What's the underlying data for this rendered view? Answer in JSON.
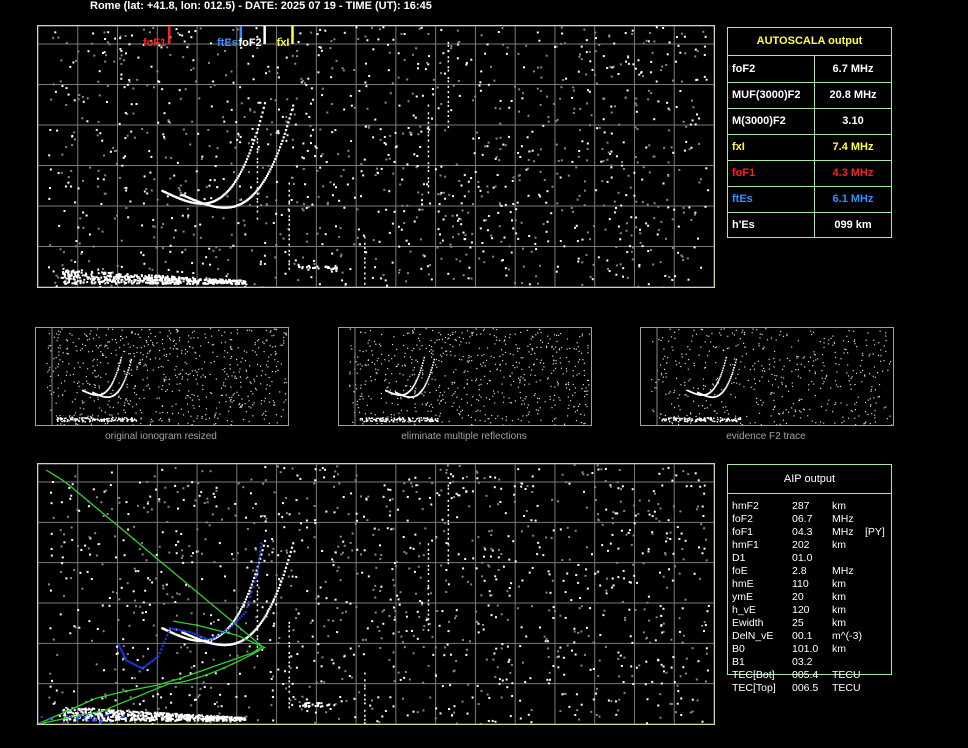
{
  "header": "Rome (lat: +41.8, lon: 012.5) - DATE: 2025 07 19 - TIME (UT): 16:45",
  "axes": {
    "y_ticks": [
      "760",
      "700",
      "600",
      "500",
      "400",
      "300",
      "200",
      "100"
    ],
    "y_unit": "km",
    "x_ticks": [
      "1",
      "2",
      "3",
      "4",
      "5",
      "6",
      "7",
      "8",
      "9",
      "10",
      "11",
      "12",
      "13",
      "14",
      "15",
      "16",
      "17",
      "18"
    ],
    "x_unit": "MHz"
  },
  "markers": [
    {
      "label": "foF1",
      "mhz": 4.3,
      "color": "#ff2020"
    },
    {
      "label": "ftEs",
      "mhz": 6.1,
      "color": "#3090ff"
    },
    {
      "label": "foF2",
      "mhz": 6.7,
      "color": "#ffffff"
    },
    {
      "label": "fxI",
      "mhz": 7.4,
      "color": "#ffff40"
    }
  ],
  "autoscala": {
    "title": "AUTOSCALA output",
    "rows": [
      {
        "key": "foF2",
        "value": "6.7 MHz",
        "color": "#ffffff"
      },
      {
        "key": "MUF(3000)F2",
        "value": "20.8 MHz",
        "color": "#ffffff"
      },
      {
        "key": "M(3000)F2",
        "value": "3.10",
        "color": "#ffffff"
      },
      {
        "key": "fxI",
        "value": "7.4 MHz",
        "color": "#ffff40"
      },
      {
        "key": "foF1",
        "value": "4.3 MHz",
        "color": "#ff2020"
      },
      {
        "key": "ftEs",
        "value": "6.1 MHz",
        "color": "#3090ff"
      },
      {
        "key": "h'Es",
        "value": "099    km",
        "color": "#ffffff"
      }
    ]
  },
  "thumbnails": [
    {
      "caption": "original ionogram resized"
    },
    {
      "caption": "eliminate multiple reflections"
    },
    {
      "caption": "evidence F2 trace"
    }
  ],
  "aip": {
    "title": "AIP output",
    "rows": [
      {
        "name": "hmF2",
        "value": "287",
        "unit": "km",
        "flag": ""
      },
      {
        "name": "foF2",
        "value": "06.7",
        "unit": "MHz",
        "flag": ""
      },
      {
        "name": "foF1",
        "value": "04.3",
        "unit": "MHz",
        "flag": "[PY]"
      },
      {
        "name": "hmF1",
        "value": "202",
        "unit": "km",
        "flag": ""
      },
      {
        "name": "D1",
        "value": "01.0",
        "unit": "",
        "flag": ""
      },
      {
        "name": "foE",
        "value": "2.8",
        "unit": "MHz",
        "flag": ""
      },
      {
        "name": "hmE",
        "value": "110",
        "unit": "km",
        "flag": ""
      },
      {
        "name": "ymE",
        "value": "20",
        "unit": "km",
        "flag": ""
      },
      {
        "name": "h_vE",
        "value": "120",
        "unit": "km",
        "flag": ""
      },
      {
        "name": "Ewidth",
        "value": "25",
        "unit": "km",
        "flag": ""
      },
      {
        "name": "DelN_vE",
        "value": "00.1",
        "unit": "m^(-3)",
        "flag": ""
      },
      {
        "name": "B0",
        "value": "101.0",
        "unit": "km",
        "flag": ""
      },
      {
        "name": "B1",
        "value": "03.2",
        "unit": "",
        "flag": ""
      },
      {
        "name": "TEC[Bot]",
        "value": "005.4",
        "unit": "TECU",
        "flag": ""
      },
      {
        "name": "TEC[Top]",
        "value": "006.5",
        "unit": "TECU",
        "flag": ""
      }
    ]
  }
}
